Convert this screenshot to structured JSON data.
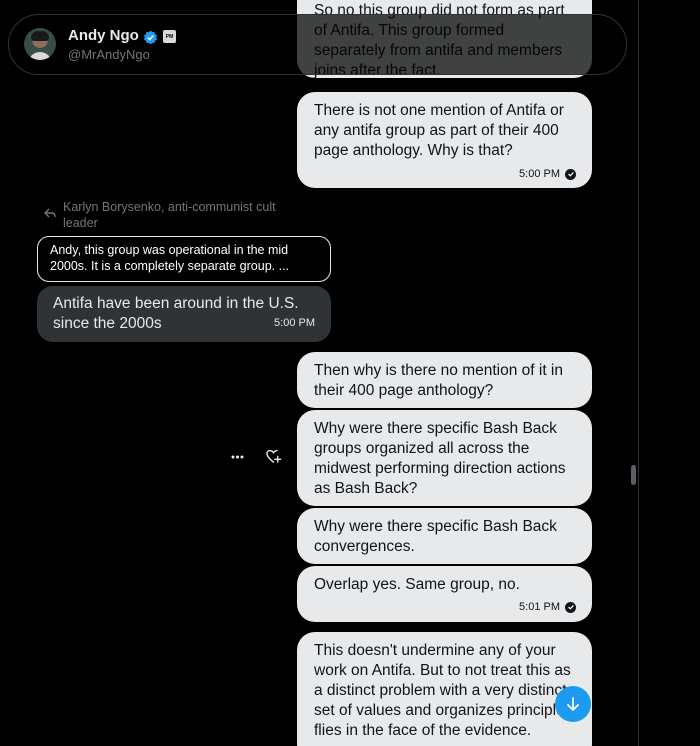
{
  "header": {
    "name": "Andy Ngo",
    "handle": "@MrAndyNgo",
    "affiliate_badge": "PM",
    "verified_color": "#1d9bf0"
  },
  "messages": {
    "m0_text": "So no this group did not form as part of Antifa. This group formed separately from antifa and members joins after the fact.",
    "m1_text": "There is not one mention of Antifa or any antifa group as part of their 400 page anthology. Why is that?",
    "m1_time": "5:00 PM",
    "reply_to_label": "Karlyn Borysenko, anti-communist cult leader",
    "quoted_text": "Andy, this group was operational in the mid 2000s. It is a completely separate group. ...",
    "m2_text": "Antifa have been around in the U.S. since the 2000s",
    "m2_time": "5:00 PM",
    "m3_text": "Then why is there no mention of it in their 400 page anthology?",
    "m4_text": "Why were there specific Bash Back groups organized all across the midwest performing direction actions as Bash Back?",
    "m5_text": "Why were there specific Bash Back convergences.",
    "m6_text": "Overlap yes. Same group, no.",
    "m6_time": "5:01 PM",
    "m7_text": "This doesn't undermine any of your work on Antifa. But to not treat this as a distinct problem with a very distinct set of values and organizes principles flies in the face of the evidence."
  },
  "colors": {
    "background": "#000000",
    "outgoing_bubble": "#e7e9ea",
    "incoming_bubble": "#2f3336",
    "accent": "#1d9bf0"
  },
  "icons": {
    "reply": "reply-arrow-icon",
    "more": "more-horizontal-icon",
    "react": "add-reaction-heart-icon",
    "scroll_down": "arrow-down-icon",
    "sent": "check-circle-icon"
  }
}
